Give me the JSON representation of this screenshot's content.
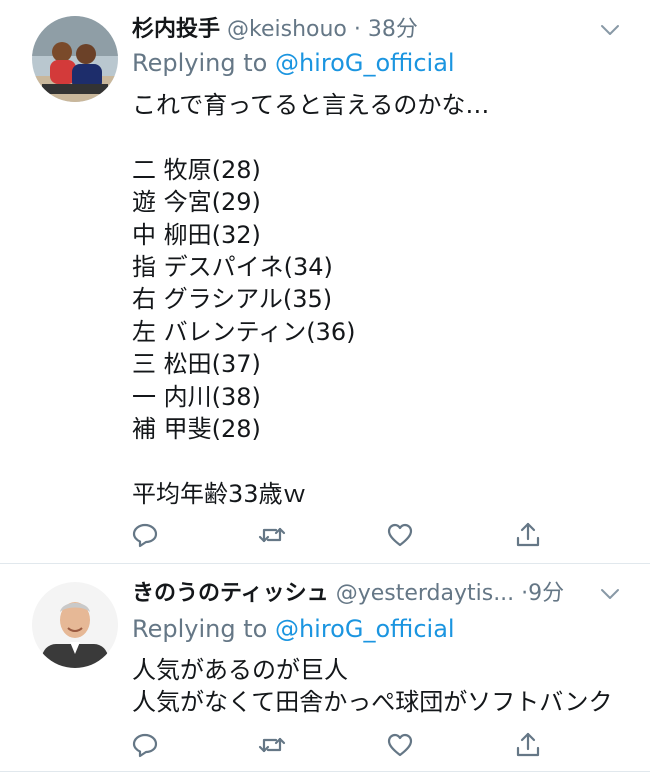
{
  "tweets": [
    {
      "name": "杉内投手",
      "handle": "@keishouo",
      "sep": "·",
      "time": "38分",
      "replying_prefix": "Replying to ",
      "replying_to": "@hiroG_official",
      "lines": [
        "これで育ってると言えるのかな…",
        "",
        "二 牧原(28)",
        "遊 今宮(29)",
        "中 柳田(32)",
        "指 デスパイネ(34)",
        "右 グラシアル(35)",
        "左 バレンティン(36)",
        "三 松田(37)",
        "一 内川(38)",
        "補 甲斐(28)",
        "",
        "平均年齢33歳ｗ"
      ]
    },
    {
      "name": "きのうのティッシュ",
      "handle": "@yesterdaytis...",
      "sep": "·",
      "time": "9分",
      "replying_prefix": "Replying to ",
      "replying_to": "@hiroG_official",
      "lines": [
        "人気があるのが巨人",
        "人気がなくて田舎かっぺ球団がソフトバンク"
      ]
    }
  ],
  "icons": {
    "reply": "reply-icon",
    "retweet": "retweet-icon",
    "like": "heart-icon",
    "share": "share-icon",
    "more": "chevron-down-icon"
  },
  "colors": {
    "text": "#14171a",
    "secondary": "#657786",
    "link": "#1b95e0",
    "divider": "#e1e8ed"
  }
}
